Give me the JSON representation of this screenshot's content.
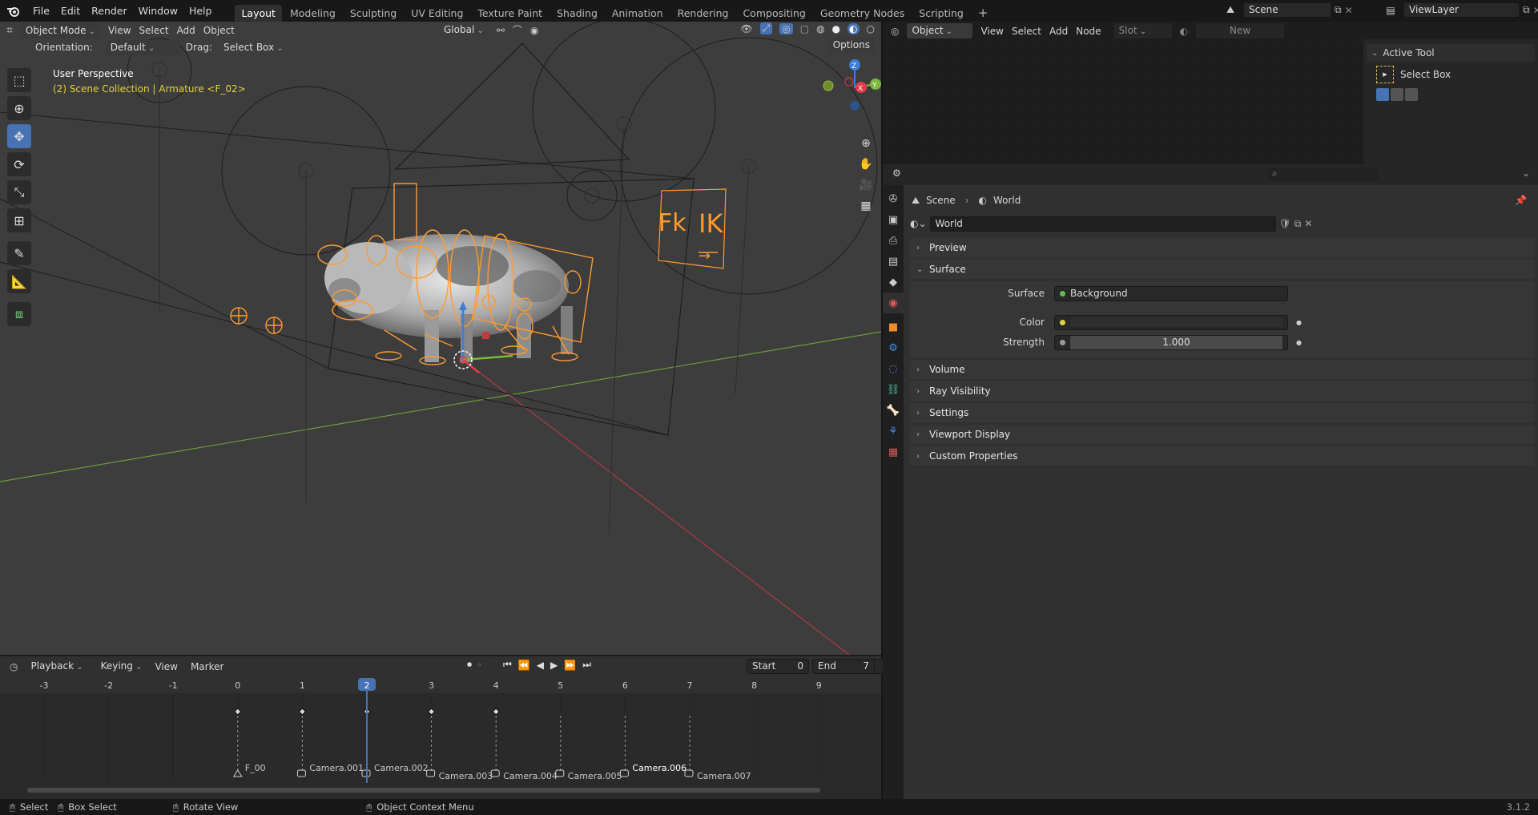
{
  "top_menu": [
    "File",
    "Edit",
    "Render",
    "Window",
    "Help"
  ],
  "workspaces": [
    "Layout",
    "Modeling",
    "Sculpting",
    "UV Editing",
    "Texture Paint",
    "Shading",
    "Animation",
    "Rendering",
    "Compositing",
    "Geometry Nodes",
    "Scripting"
  ],
  "active_workspace": "Layout",
  "add_workspace": "+",
  "scene_name": "Scene",
  "view_layer": "ViewLayer",
  "viewport": {
    "mode": "Object Mode",
    "menus": [
      "View",
      "Select",
      "Add",
      "Object"
    ],
    "transform_orientation": "Global",
    "orientation_label": "Orientation:",
    "orientation_value": "Default",
    "drag_label": "Drag:",
    "drag_value": "Select Box",
    "options": "Options",
    "overlay_title": "User Perspective",
    "overlay_subtitle": "(2) Scene Collection | Armature <F_02>",
    "gizmo_axes": {
      "x": "X",
      "y": "Y",
      "z": "Z"
    },
    "fk_label": "Fk",
    "ik_label": "IK",
    "ik_arrow": "→"
  },
  "tools": [
    "select-box",
    "cursor",
    "move",
    "rotate",
    "scale",
    "transform",
    "annotate",
    "measure",
    "add-cube"
  ],
  "timeline": {
    "editor_menus": [
      "Playback",
      "Keying",
      "View",
      "Marker"
    ],
    "current_frame": "2",
    "start_label": "Start",
    "start_value": "0",
    "end_label": "End",
    "end_value": "7",
    "frame_ticks": [
      "-3",
      "-2",
      "-1",
      "0",
      "1",
      "2",
      "3",
      "4",
      "5",
      "6",
      "7",
      "8",
      "9"
    ],
    "markers": [
      {
        "label": "F_00",
        "frame": 0,
        "kind": "marker"
      },
      {
        "label": "Camera.001",
        "frame": 1,
        "kind": "camera"
      },
      {
        "label": "Camera.002",
        "frame": 2,
        "kind": "camera"
      },
      {
        "label": "Camera.003",
        "frame": 3,
        "kind": "camera"
      },
      {
        "label": "Camera.004",
        "frame": 4,
        "kind": "camera"
      },
      {
        "label": "Camera.005",
        "frame": 5,
        "kind": "camera"
      },
      {
        "label": "Camera.006",
        "frame": 6,
        "kind": "camera"
      },
      {
        "label": "Camera.007",
        "frame": 7,
        "kind": "camera"
      }
    ],
    "keyframes": [
      0,
      1,
      2,
      3,
      4
    ]
  },
  "shader_header": {
    "type": "Object",
    "menus": [
      "View",
      "Select",
      "Add",
      "Node"
    ],
    "slot": "Slot",
    "new": "New"
  },
  "active_tool": {
    "title": "Active Tool",
    "tool_name": "Select Box"
  },
  "properties": {
    "breadcrumb": [
      "Scene",
      "World"
    ],
    "world_name": "World",
    "panels": [
      {
        "label": "Preview",
        "open": false
      },
      {
        "label": "Surface",
        "open": true
      }
    ],
    "surface": {
      "surface_label": "Surface",
      "surface_value": "Background",
      "color_label": "Color",
      "strength_label": "Strength",
      "strength_value": "1.000"
    },
    "closed_panels": [
      "Volume",
      "Ray Visibility",
      "Settings",
      "Viewport Display",
      "Custom Properties"
    ]
  },
  "statusbar": {
    "select": "Select",
    "box_select": "Box Select",
    "rotate_view": "Rotate View",
    "context_menu": "Object Context Menu",
    "version": "3.1.2"
  },
  "colors": {
    "accent": "#4772b3",
    "armature_orange": "#ff9a2e",
    "axis_red": "#e23c4a",
    "axis_green": "#7bb93d",
    "axis_blue": "#3b7dd8",
    "playhead": "#4772b3",
    "surface_dot": "#5ec34b",
    "color_dot": "#e6d23c"
  }
}
